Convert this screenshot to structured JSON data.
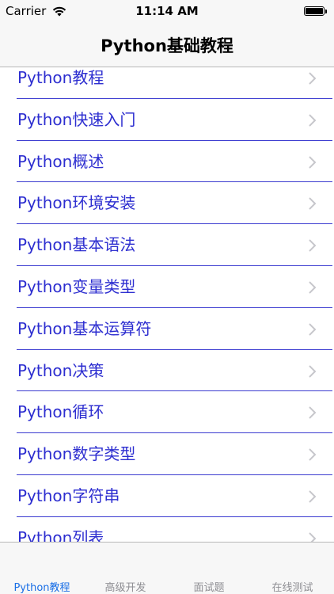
{
  "status_bar": {
    "carrier": "Carrier",
    "time": "11:14 AM",
    "battery_level": 1.0
  },
  "nav": {
    "title": "Python基础教程"
  },
  "list": {
    "items": [
      {
        "label": "Python教程"
      },
      {
        "label": "Python快速入门"
      },
      {
        "label": "Python概述"
      },
      {
        "label": "Python环境安装"
      },
      {
        "label": "Python基本语法"
      },
      {
        "label": "Python变量类型"
      },
      {
        "label": "Python基本运算符"
      },
      {
        "label": "Python决策"
      },
      {
        "label": "Python循环"
      },
      {
        "label": "Python数字类型"
      },
      {
        "label": "Python字符串"
      },
      {
        "label": "Python列表"
      }
    ]
  },
  "tab_bar": {
    "tabs": [
      {
        "label": "Python教程",
        "active": true
      },
      {
        "label": "高级开发",
        "active": false
      },
      {
        "label": "面试题",
        "active": false
      },
      {
        "label": "在线测试",
        "active": false
      }
    ]
  },
  "colors": {
    "item_text": "#2d2ed0",
    "separator": "#3b3bd0",
    "tab_active": "#1a6fe6",
    "tab_inactive": "#8e8e93"
  }
}
